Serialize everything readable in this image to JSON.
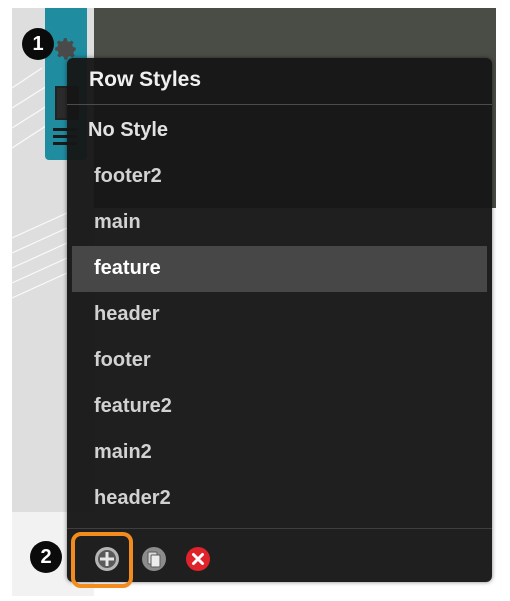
{
  "panel": {
    "title": "Row Styles",
    "styles": [
      {
        "label": "No Style"
      },
      {
        "label": "footer2"
      },
      {
        "label": "main"
      },
      {
        "label": "feature",
        "selected": true
      },
      {
        "label": "header"
      },
      {
        "label": "footer"
      },
      {
        "label": "feature2"
      },
      {
        "label": "main2"
      },
      {
        "label": "header2"
      }
    ],
    "toolbar": {
      "add_icon": "plus-circle-icon",
      "copy_icon": "duplicate-icon",
      "delete_icon": "delete-x-icon"
    }
  },
  "callouts": {
    "marker_1": "1",
    "marker_2": "2"
  },
  "colors": {
    "accent_highlight": "#f28c1e",
    "widget_teal": "#1f8ca0",
    "delete_red": "#e0232a",
    "panel_bg": "#161616",
    "selected_bg": "#474747"
  }
}
